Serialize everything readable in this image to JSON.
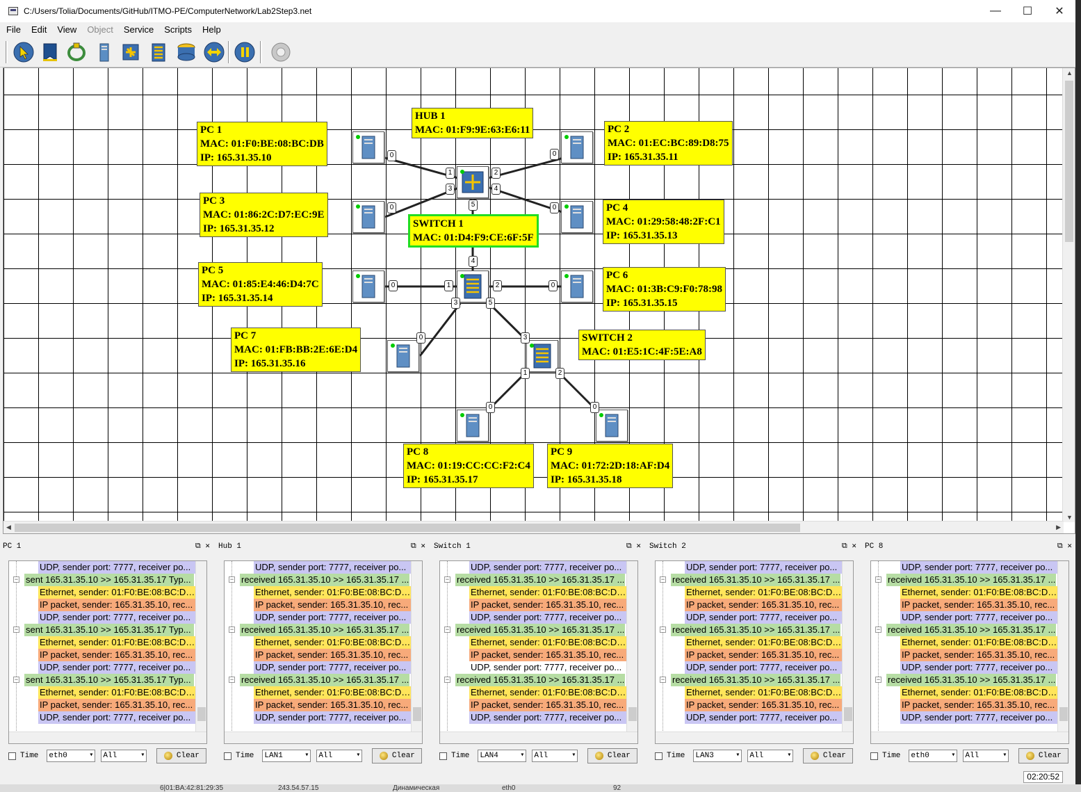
{
  "window": {
    "title": "C:/Users/Tolia/Documents/GitHub/ITMO-PE/ComputerNetwork/Lab2Step3.net"
  },
  "menu": [
    "File",
    "Edit",
    "View",
    "Object",
    "Service",
    "Scripts",
    "Help"
  ],
  "toolbar": [
    "pointer-tool",
    "note-tool",
    "cable-tool",
    "computer-tool",
    "hub-tool",
    "switch-tool",
    "router-tool",
    "connect-tool",
    "pause-tool",
    "settings-tool"
  ],
  "labels": {
    "pc1": [
      "PC 1",
      "MAC: 01:F0:BE:08:BC:DB",
      "IP: 165.31.35.10"
    ],
    "hub1": [
      "HUB 1",
      "MAC: 01:F9:9E:63:E6:11"
    ],
    "pc2": [
      "PC 2",
      "MAC: 01:EC:BC:89:D8:75",
      "IP: 165.31.35.11"
    ],
    "pc3": [
      "PC 3",
      "MAC: 01:86:2C:D7:EC:9E",
      "IP: 165.31.35.12"
    ],
    "switch1": [
      "SWITCH 1",
      "MAC: 01:D4:F9:CE:6F:5F"
    ],
    "pc4": [
      "PC 4",
      "MAC: 01:29:58:48:2F:C1",
      "IP: 165.31.35.13"
    ],
    "pc5": [
      "PC 5",
      "MAC: 01:85:E4:46:D4:7C",
      "IP: 165.31.35.14"
    ],
    "pc6": [
      "PC 6",
      "MAC: 01:3B:C9:F0:78:98",
      "IP: 165.31.35.15"
    ],
    "pc7": [
      "PC 7",
      "MAC: 01:FB:BB:2E:6E:D4",
      "IP: 165.31.35.16"
    ],
    "switch2": [
      "SWITCH 2",
      "MAC: 01:E5:1C:4F:5E:A8"
    ],
    "pc8": [
      "PC 8",
      "MAC: 01:19:CC:CC:F2:C4",
      "IP: 165.31.35.17"
    ],
    "pc9": [
      "PC 9",
      "MAC: 01:72:2D:18:AF:D4",
      "IP: 165.31.35.18"
    ]
  },
  "ports": [
    "0",
    "1",
    "2",
    "3",
    "4",
    "5"
  ],
  "panels": [
    {
      "title": "PC 1",
      "rows": [
        {
          "t": "udp",
          "text": "UDP, sender port: 7777, receiver po..."
        },
        {
          "t": "top",
          "text": "sent 165.31.35.10 >> 165.31.35.17 Typ..."
        },
        {
          "t": "eth",
          "text": "Ethernet, sender: 01:F0:BE:08:BC:DB..."
        },
        {
          "t": "ip",
          "text": "IP packet, sender: 165.31.35.10, rec..."
        },
        {
          "t": "udp",
          "text": "UDP, sender port: 7777, receiver po..."
        },
        {
          "t": "top",
          "text": "sent 165.31.35.10 >> 165.31.35.17 Typ..."
        },
        {
          "t": "eth",
          "text": "Ethernet, sender: 01:F0:BE:08:BC:DB..."
        },
        {
          "t": "ip",
          "text": "IP packet, sender: 165.31.35.10, rec..."
        },
        {
          "t": "udp",
          "text": "UDP, sender port: 7777, receiver po..."
        },
        {
          "t": "top",
          "text": "sent 165.31.35.10 >> 165.31.35.17 Typ..."
        },
        {
          "t": "eth",
          "text": "Ethernet, sender: 01:F0:BE:08:BC:DB..."
        },
        {
          "t": "ip",
          "text": "IP packet, sender: 165.31.35.10, rec..."
        },
        {
          "t": "udp",
          "text": "UDP, sender port: 7777, receiver po..."
        }
      ],
      "time_label": "Time",
      "iface": "eth0",
      "filter": "All",
      "clear": "Clear"
    },
    {
      "title": "Hub 1",
      "rows": [
        {
          "t": "udp",
          "text": "UDP, sender port: 7777, receiver po..."
        },
        {
          "t": "top",
          "text": "received 165.31.35.10 >> 165.31.35.17 ..."
        },
        {
          "t": "eth",
          "text": "Ethernet, sender: 01:F0:BE:08:BC:DB..."
        },
        {
          "t": "ip",
          "text": "IP packet, sender: 165.31.35.10, rec..."
        },
        {
          "t": "udp",
          "text": "UDP, sender port: 7777, receiver po..."
        },
        {
          "t": "top",
          "text": "received 165.31.35.10 >> 165.31.35.17 ..."
        },
        {
          "t": "eth",
          "text": "Ethernet, sender: 01:F0:BE:08:BC:DB..."
        },
        {
          "t": "ip",
          "text": "IP packet, sender: 165.31.35.10, rec..."
        },
        {
          "t": "udp",
          "text": "UDP, sender port: 7777, receiver po..."
        },
        {
          "t": "top",
          "text": "received 165.31.35.10 >> 165.31.35.17 ..."
        },
        {
          "t": "eth",
          "text": "Ethernet, sender: 01:F0:BE:08:BC:DB..."
        },
        {
          "t": "ip",
          "text": "IP packet, sender: 165.31.35.10, rec..."
        },
        {
          "t": "udp",
          "text": "UDP, sender port: 7777, receiver po..."
        }
      ],
      "time_label": "Time",
      "iface": "LAN1",
      "filter": "All",
      "clear": "Clear"
    },
    {
      "title": "Switch 1",
      "rows": [
        {
          "t": "udp",
          "text": "UDP, sender port: 7777, receiver po..."
        },
        {
          "t": "top",
          "text": "received 165.31.35.10 >> 165.31.35.17 ..."
        },
        {
          "t": "eth",
          "text": "Ethernet, sender: 01:F0:BE:08:BC:DB..."
        },
        {
          "t": "ip",
          "text": "IP packet, sender: 165.31.35.10, rec..."
        },
        {
          "t": "udp",
          "text": "UDP, sender port: 7777, receiver po..."
        },
        {
          "t": "top",
          "text": "received 165.31.35.10 >> 165.31.35.17 ..."
        },
        {
          "t": "eth",
          "text": "Ethernet, sender: 01:F0:BE:08:BC:DB..."
        },
        {
          "t": "ip",
          "text": "IP packet, sender: 165.31.35.10, rec..."
        },
        {
          "t": "plain",
          "text": "UDP, sender port: 7777, receiver po..."
        },
        {
          "t": "top",
          "text": "received 165.31.35.10 >> 165.31.35.17 ..."
        },
        {
          "t": "eth",
          "text": "Ethernet, sender: 01:F0:BE:08:BC:DB..."
        },
        {
          "t": "ip",
          "text": "IP packet, sender: 165.31.35.10, rec..."
        },
        {
          "t": "udp",
          "text": "UDP, sender port: 7777, receiver po..."
        }
      ],
      "time_label": "Time",
      "iface": "LAN4",
      "filter": "All",
      "clear": "Clear"
    },
    {
      "title": "Switch 2",
      "rows": [
        {
          "t": "udp",
          "text": "UDP, sender port: 7777, receiver po..."
        },
        {
          "t": "top",
          "text": "received 165.31.35.10 >> 165.31.35.17 ..."
        },
        {
          "t": "eth",
          "text": "Ethernet, sender: 01:F0:BE:08:BC:DB..."
        },
        {
          "t": "ip",
          "text": "IP packet, sender: 165.31.35.10, rec..."
        },
        {
          "t": "udp",
          "text": "UDP, sender port: 7777, receiver po..."
        },
        {
          "t": "top",
          "text": "received 165.31.35.10 >> 165.31.35.17 ..."
        },
        {
          "t": "eth",
          "text": "Ethernet, sender: 01:F0:BE:08:BC:DB..."
        },
        {
          "t": "ip",
          "text": "IP packet, sender: 165.31.35.10, rec..."
        },
        {
          "t": "udp",
          "text": "UDP, sender port: 7777, receiver po..."
        },
        {
          "t": "top",
          "text": "received 165.31.35.10 >> 165.31.35.17 ..."
        },
        {
          "t": "eth",
          "text": "Ethernet, sender: 01:F0:BE:08:BC:DB..."
        },
        {
          "t": "ip",
          "text": "IP packet, sender: 165.31.35.10, rec..."
        },
        {
          "t": "udp",
          "text": "UDP, sender port: 7777, receiver po..."
        }
      ],
      "time_label": "Time",
      "iface": "LAN3",
      "filter": "All",
      "clear": "Clear"
    },
    {
      "title": "PC 8",
      "rows": [
        {
          "t": "udp",
          "text": "UDP, sender port: 7777, receiver po..."
        },
        {
          "t": "top",
          "text": "received 165.31.35.10 >> 165.31.35.17 ..."
        },
        {
          "t": "eth",
          "text": "Ethernet, sender: 01:F0:BE:08:BC:DB..."
        },
        {
          "t": "ip",
          "text": "IP packet, sender: 165.31.35.10, rec..."
        },
        {
          "t": "udp",
          "text": "UDP, sender port: 7777, receiver po..."
        },
        {
          "t": "top",
          "text": "received 165.31.35.10 >> 165.31.35.17 ..."
        },
        {
          "t": "eth",
          "text": "Ethernet, sender: 01:F0:BE:08:BC:DB..."
        },
        {
          "t": "ip",
          "text": "IP packet, sender: 165.31.35.10, rec..."
        },
        {
          "t": "udp",
          "text": "UDP, sender port: 7777, receiver po..."
        },
        {
          "t": "top",
          "text": "received 165.31.35.10 >> 165.31.35.17 ..."
        },
        {
          "t": "eth",
          "text": "Ethernet, sender: 01:F0:BE:08:BC:DB..."
        },
        {
          "t": "ip",
          "text": "IP packet, sender: 165.31.35.10, rec..."
        },
        {
          "t": "udp",
          "text": "UDP, sender port: 7777, receiver po..."
        }
      ],
      "time_label": "Time",
      "iface": "eth0",
      "filter": "All",
      "clear": "Clear"
    }
  ],
  "status": {
    "clock": "02:20:52"
  },
  "taskstrip": [
    "6|01:BA:42:81:29:35",
    "243.54.57.15",
    "Динамическая",
    "eth0",
    "92"
  ]
}
